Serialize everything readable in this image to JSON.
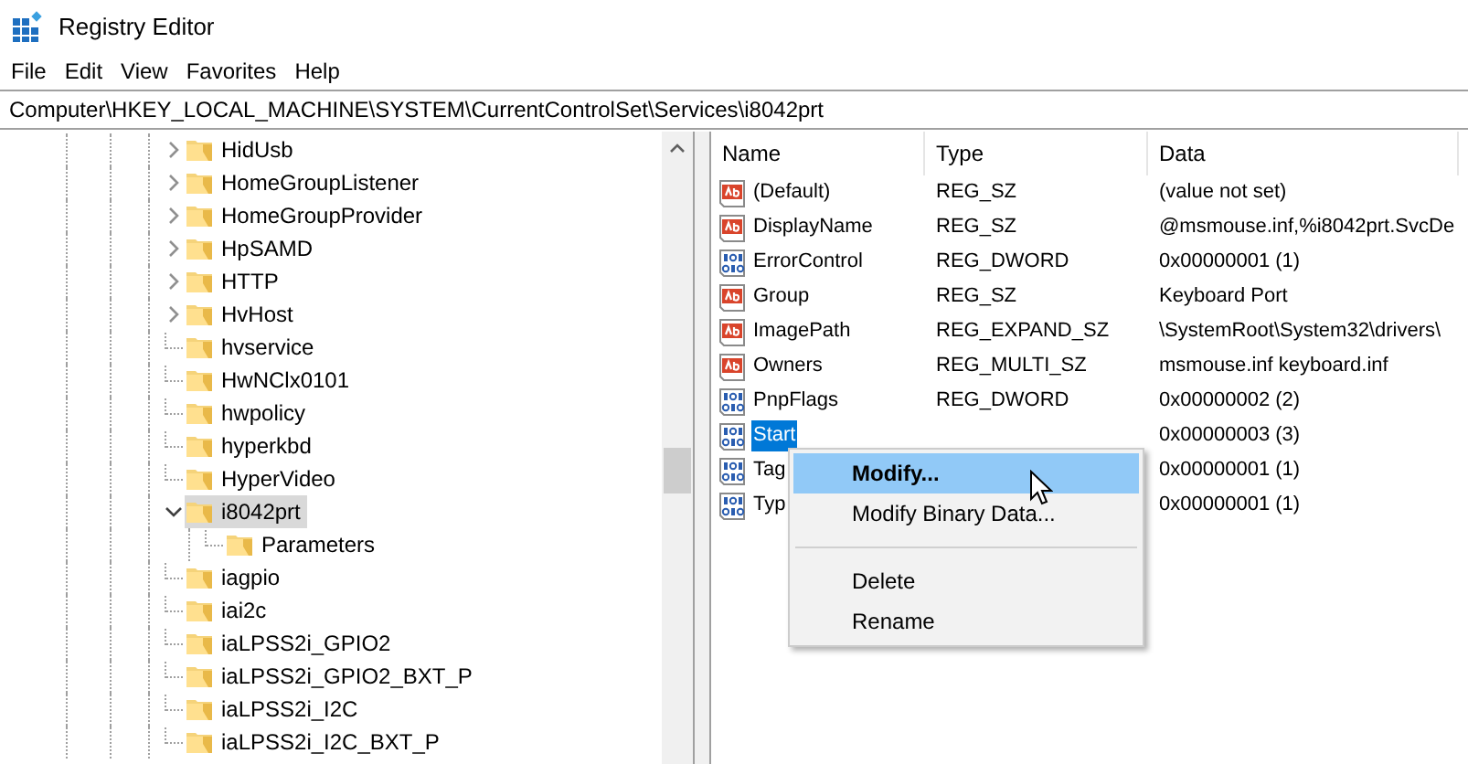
{
  "window": {
    "title": "Registry Editor"
  },
  "menu": [
    "File",
    "Edit",
    "View",
    "Favorites",
    "Help"
  ],
  "address": "Computer\\HKEY_LOCAL_MACHINE\\SYSTEM\\CurrentControlSet\\Services\\i8042prt",
  "tree": [
    {
      "label": "HidUsb",
      "expanded": false,
      "selected": false
    },
    {
      "label": "HomeGroupListener",
      "expanded": false,
      "selected": false
    },
    {
      "label": "HomeGroupProvider",
      "expanded": false,
      "selected": false
    },
    {
      "label": "HpSAMD",
      "expanded": false,
      "selected": false
    },
    {
      "label": "HTTP",
      "expanded": false,
      "selected": false
    },
    {
      "label": "HvHost",
      "expanded": false,
      "selected": false
    },
    {
      "label": "hvservice",
      "selected": false
    },
    {
      "label": "HwNClx0101",
      "selected": false
    },
    {
      "label": "hwpolicy",
      "selected": false
    },
    {
      "label": "hyperkbd",
      "selected": false
    },
    {
      "label": "HyperVideo",
      "selected": false
    },
    {
      "label": "i8042prt",
      "expanded": true,
      "selected": true,
      "children": [
        {
          "label": "Parameters",
          "selected": false
        }
      ]
    },
    {
      "label": "iagpio",
      "selected": false
    },
    {
      "label": "iai2c",
      "selected": false
    },
    {
      "label": "iaLPSS2i_GPIO2",
      "selected": false
    },
    {
      "label": "iaLPSS2i_GPIO2_BXT_P",
      "selected": false
    },
    {
      "label": "iaLPSS2i_I2C",
      "selected": false
    },
    {
      "label": "iaLPSS2i_I2C_BXT_P",
      "selected": false
    }
  ],
  "values": {
    "columns": [
      "Name",
      "Type",
      "Data"
    ],
    "rows": [
      {
        "kind": "string",
        "name": "(Default)",
        "type": "REG_SZ",
        "data": "(value not set)",
        "selected": false
      },
      {
        "kind": "string",
        "name": "DisplayName",
        "type": "REG_SZ",
        "data": "@msmouse.inf,%i8042prt.SvcDe",
        "selected": false
      },
      {
        "kind": "binary",
        "name": "ErrorControl",
        "type": "REG_DWORD",
        "data": "0x00000001 (1)",
        "selected": false
      },
      {
        "kind": "string",
        "name": "Group",
        "type": "REG_SZ",
        "data": "Keyboard Port",
        "selected": false
      },
      {
        "kind": "string",
        "name": "ImagePath",
        "type": "REG_EXPAND_SZ",
        "data": "\\SystemRoot\\System32\\drivers\\",
        "selected": false
      },
      {
        "kind": "string",
        "name": "Owners",
        "type": "REG_MULTI_SZ",
        "data": "msmouse.inf keyboard.inf",
        "selected": false
      },
      {
        "kind": "binary",
        "name": "PnpFlags",
        "type": "REG_DWORD",
        "data": "0x00000002 (2)",
        "selected": false
      },
      {
        "kind": "binary",
        "name": "Start",
        "data": "0x00000003 (3)",
        "selected": true
      },
      {
        "kind": "binary",
        "name": "Tag",
        "data": "0x00000001 (1)",
        "selected": false
      },
      {
        "kind": "binary",
        "name": "Typ",
        "data": "0x00000001 (1)",
        "selected": false
      }
    ]
  },
  "context_menu": [
    {
      "kind": "item",
      "label": "Modify...",
      "default": true,
      "selected": true
    },
    {
      "kind": "item",
      "label": "Modify Binary Data...",
      "default": false,
      "selected": false
    },
    {
      "kind": "separator"
    },
    {
      "kind": "item",
      "label": "Delete",
      "default": false,
      "selected": false
    },
    {
      "kind": "item",
      "label": "Rename",
      "default": false,
      "selected": false
    }
  ]
}
